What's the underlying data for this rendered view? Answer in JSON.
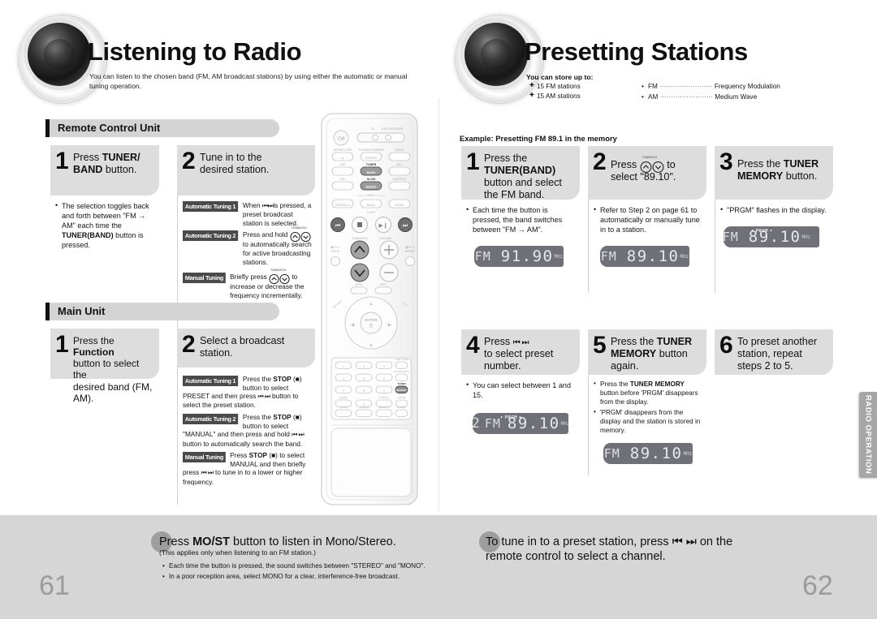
{
  "left_page": {
    "number": "61",
    "title": "Listening to Radio",
    "subtitle": "You can listen to the chosen band (FM, AM broadcast stations) by using either the automatic or manual tuning operation.",
    "sections": [
      {
        "id": "remote-control-unit",
        "label": "Remote Control Unit"
      },
      {
        "id": "main-unit",
        "label": "Main Unit"
      }
    ],
    "remote_steps": [
      {
        "number": "1",
        "head_html": "Press <b>TUNER/</b><br><b>BAND</b> button.",
        "bullets": [
          "The selection toggles back and forth between \"FM → AM\" each time the <b>TUNER(BAND)</b> button is pressed."
        ]
      },
      {
        "number": "2",
        "head_html": "Tune in to the<br>desired station.",
        "tuning": [
          {
            "chip": "Automatic Tuning 1",
            "text": "When ⏮ ⏭ is pressed, a preset broadcast station is selected."
          },
          {
            "chip": "Automatic Tuning 2",
            "text": "Press and hold △▽ to automatically search for active broadcasting stations."
          },
          {
            "chip": "Manual Tuning",
            "text": "Briefly press △▽ to increase or decrease the frequency incrementally."
          }
        ]
      }
    ],
    "main_steps": [
      {
        "number": "1",
        "head_html": "Press the <b>Function</b><br>button to select the<br>desired band (FM,<br>AM)."
      },
      {
        "number": "2",
        "head_html": "Select a broadcast<br>station.",
        "tuning": [
          {
            "chip": "Automatic Tuning 1",
            "text": "Press the <b>STOP</b> (■) button to select PRESET and then press ⏮ ⏭ button to select the preset station."
          },
          {
            "chip": "Automatic Tuning 2",
            "text": "Press the <b>STOP</b> (■) button to select \"MANUAL\" and then press and hold ⏮ ⏭ button to automatically search the band."
          },
          {
            "chip": "Manual Tuning",
            "text": "Press <b>STOP</b> (■) to select MANUAL and then briefly press ⏮ ⏭ to tune in to a lower or higher frequency."
          }
        ]
      }
    ],
    "note": {
      "title_html": "Press <b>MO/ST</b> button to listen in Mono/Stereo.",
      "subtitle": "(This applies only when listening to an FM station.)",
      "bullets": [
        "Each time the button is pressed, the sound switches between \"STEREO\" and \"MONO\".",
        "In a poor reception area, select MONO for a clear, interference-free broadcast."
      ]
    }
  },
  "right_page": {
    "number": "62",
    "title": "Presetting Stations",
    "store_heading": "You can store up to:",
    "store_items": [
      "15 FM stations",
      "15 AM stations"
    ],
    "band_key": [
      {
        "abbr": "FM",
        "dots": "························",
        "meaning": "Frequency Modulation"
      },
      {
        "abbr": "AM",
        "dots": "························",
        "meaning": "Medium Wave"
      }
    ],
    "example_label": "Example: Presetting FM 89.1 in the memory",
    "steps": [
      {
        "number": "1",
        "head_html": "Press the<br><b>TUNER(BAND)</b><br>button  and select<br>the FM band.",
        "bullets": [
          "Each time the button is pressed, the band switches between \"FM → AM\"."
        ],
        "display": {
          "preset": "",
          "band": "FM",
          "freq": "91.90",
          "unit": "MHz",
          "prgm": false
        }
      },
      {
        "number": "2",
        "head_html": "Press △▽ to<br>select \"89.10\".",
        "bullets": [
          "Refer to Step 2 on page 61 to automatically or manually tune in to a station."
        ],
        "display": {
          "preset": "",
          "band": "FM",
          "freq": "89.10",
          "unit": "MHz",
          "prgm": false
        }
      },
      {
        "number": "3",
        "head_html": "Press the <b>TUNER</b><br><b>MEMORY</b> button.",
        "bullets": [
          "\"PRGM\" flashes in the display."
        ],
        "display": {
          "preset": "",
          "band": "FM",
          "freq": "89.10",
          "unit": "MHz",
          "prgm": true,
          "prgm_label": "PRGM"
        }
      },
      {
        "number": "4",
        "head_html": "Press ⏮ ⏭<br>to select preset<br>number.",
        "bullets": [
          "You can select between 1 and 15."
        ],
        "display": {
          "preset": "2",
          "band": "FM",
          "freq": "89.10",
          "unit": "MHz",
          "prgm": true,
          "prgm_label": "PRGM"
        }
      },
      {
        "number": "5",
        "head_html": "Press the <b>TUNER</b><br><b>MEMORY</b> button<br>again.",
        "bullets": [
          "Press the <b>TUNER MEMORY</b> button before 'PRGM' disappears from the display.",
          "'PRGM' disappears from the display and the station is stored in memory."
        ],
        "display": {
          "preset": "",
          "band": "FM",
          "freq": "89.10",
          "unit": "MHz",
          "prgm": false
        }
      },
      {
        "number": "6",
        "head_html": "To preset another<br>station, repeat<br>steps 2 to 5."
      }
    ],
    "note": {
      "title_html": "To tune in to a preset station, press  ⏮ ⏭  on the<br>remote control to select a channel."
    }
  },
  "side_tab": {
    "label": "RADIO OPERATION"
  },
  "remote_illustration": {
    "name": "remote-control-diagram",
    "highlighted_buttons": [
      "TUNER/BAND",
      "MO/ST",
      "skip-back",
      "skip-forward",
      "tuning-up",
      "tuning-down",
      "TUNER MEMORY"
    ],
    "labels": {
      "power": "⏻/I",
      "tv_dvd": [
        "TV",
        "DVD RECEIVER"
      ],
      "row1": [
        "OPEN/CLOSE",
        "TV/VIDEO DIMMER",
        "MODE"
      ],
      "row2": [
        "DVD",
        "TUNER BAND",
        "AUX"
      ],
      "row3": [
        "ASC",
        "SLOW",
        "SUBTITLE"
      ],
      "row3b": "MO/ST",
      "row4": [
        "SUPER 5.1",
        "MUSIC",
        "MOVIE"
      ],
      "dsp": "DSP",
      "vamp": "V-AMP",
      "transport": [
        "⏮",
        "■",
        "▶‖",
        "⏭"
      ],
      "tuning": "TUNING/CH",
      "volume": "VOLUME",
      "dolby_mode": "DOLBY PLII MODE",
      "dolby_effect": "DOLBY PLII EFFECT",
      "enter": "ENTER",
      "keypad": [
        "1",
        "2",
        "3",
        "4",
        "5",
        "6",
        "7",
        "8",
        "9",
        "0"
      ],
      "keypad_side": [
        "TEST TONE",
        "SOUND EDIT",
        "TUNER MEMORY"
      ],
      "keypad_bottom": [
        "TUNER",
        "CANCEL",
        "ZOOM",
        "LOGO",
        "P.SCAN",
        "REPEAT",
        "ANGLE"
      ]
    }
  }
}
